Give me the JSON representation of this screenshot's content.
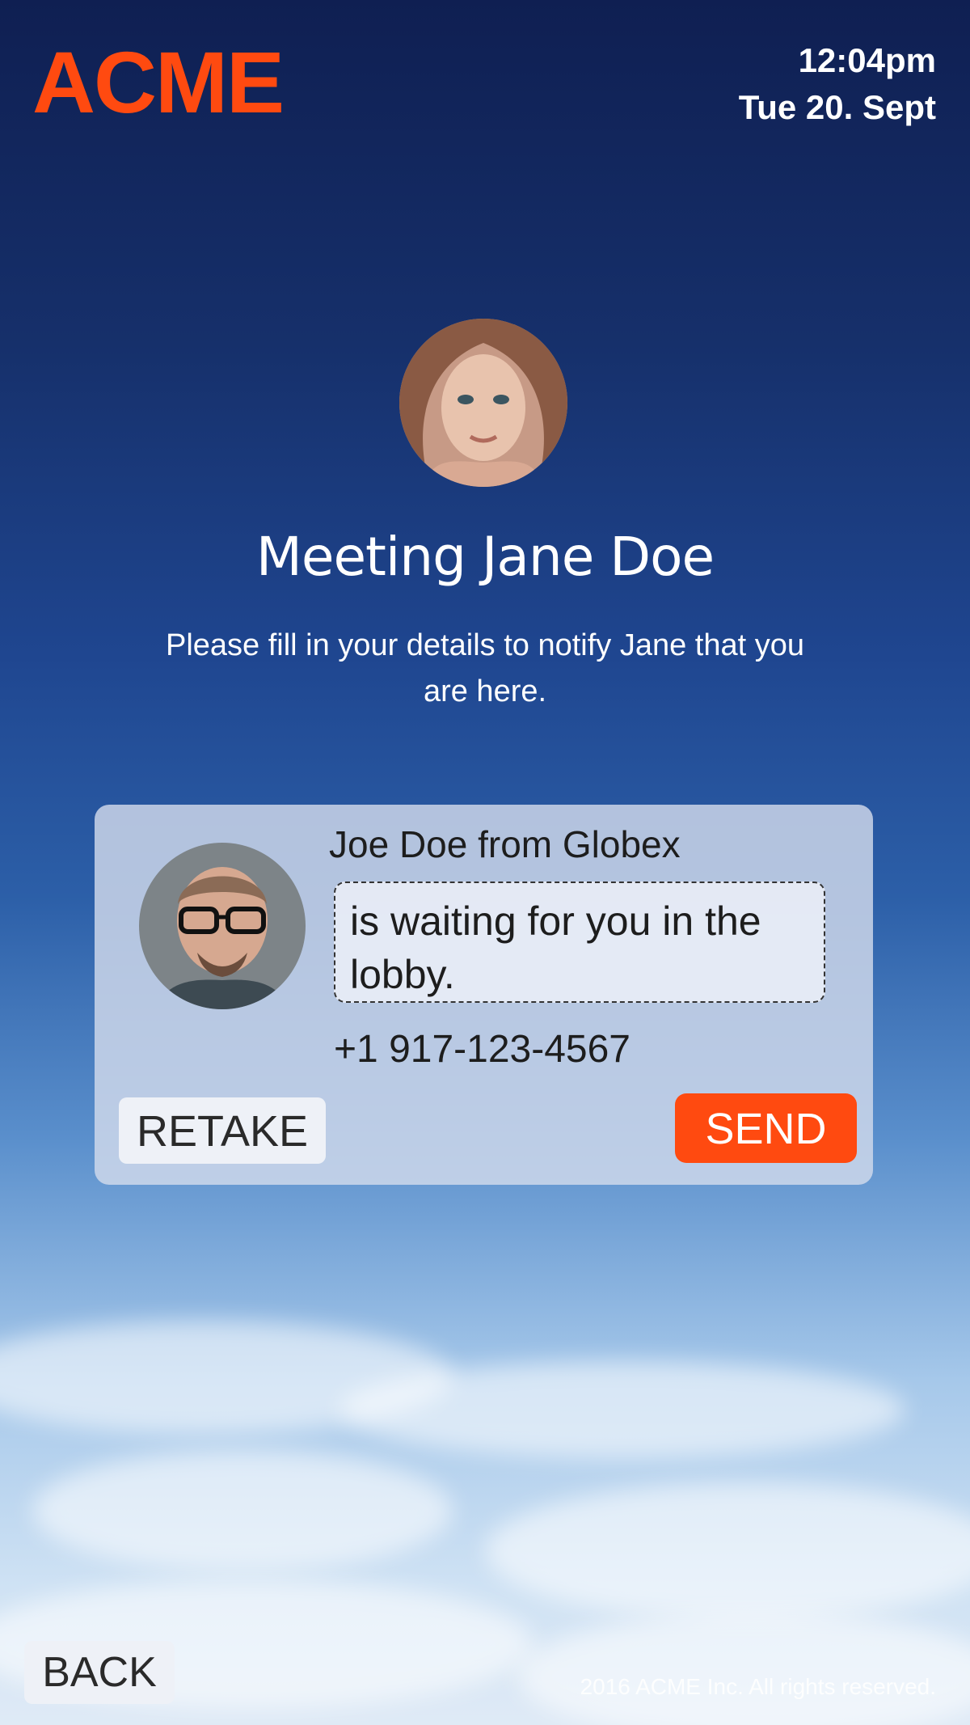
{
  "header": {
    "logo_text": "ACME",
    "time": "12:04pm",
    "date": "Tue 20. Sept"
  },
  "host": {
    "avatar_icon": "host-avatar",
    "title": "Meeting Jane Doe",
    "instructions": "Please fill in your details to notify Jane that you are here."
  },
  "card": {
    "avatar_icon": "guest-avatar",
    "guest_name": "Joe Doe from Globex",
    "message": "is waiting for you in the lobby.",
    "phone": "+1 917-123-4567",
    "retake_label": "RETAKE",
    "send_label": "SEND"
  },
  "footer": {
    "back_label": "BACK",
    "copyright": "2016 ACME Inc. All rights reserved."
  },
  "colors": {
    "brand": "#ff4a10",
    "sky_top": "#0f1f52",
    "sky_bottom": "#dfeaf6"
  }
}
